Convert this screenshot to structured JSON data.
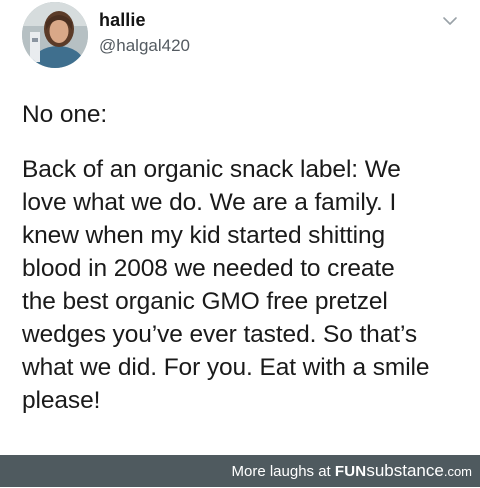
{
  "tweet": {
    "display_name": "hallie",
    "handle": "@halgal420",
    "lead": "No one:",
    "body": "Back of an organic snack label: We\nlove what we do. We are a family. I\nknew when my kid started shitting\nblood in 2008 we needed to create\nthe best organic GMO free pretzel\nwedges you’ve ever tasted. So that’s\nwhat we did. For you. Eat with a smile\nplease!",
    "menu_icon": "chevron-down-icon",
    "avatar_icon": "profile-photo"
  },
  "watermark": {
    "prefix": "More laughs at ",
    "brand_bold": "FUN",
    "brand_regular": "substance",
    "suffix": ".com",
    "background": "#4f5a5f"
  }
}
